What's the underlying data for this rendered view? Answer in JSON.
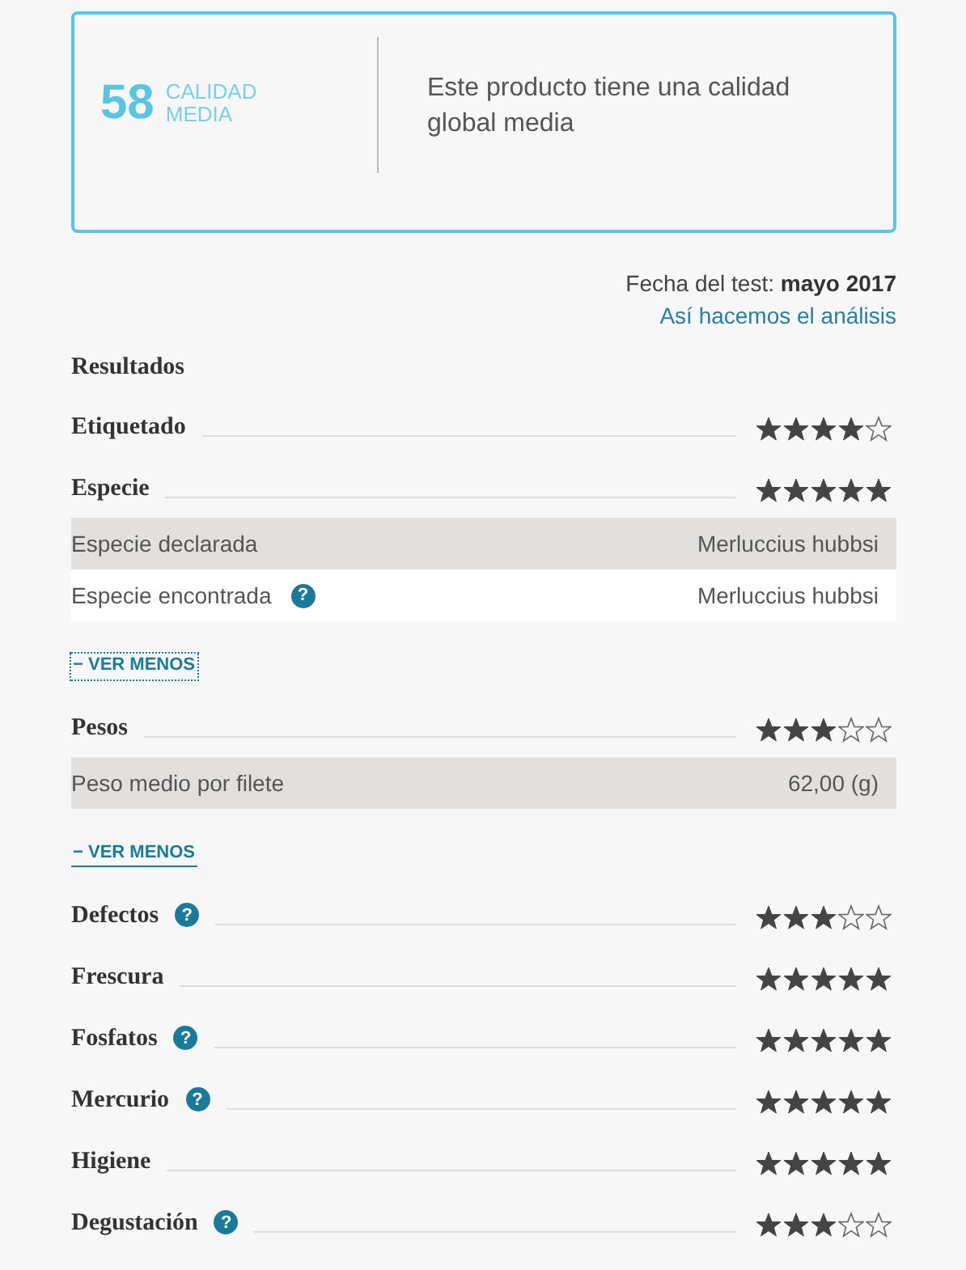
{
  "summary": {
    "score": "58",
    "grade_line_1": "CALIDAD",
    "grade_line_2": "MEDIA",
    "description": "Este producto tiene una calidad global media"
  },
  "test_date": {
    "label": "Fecha del test:",
    "value": "mayo 2017"
  },
  "method_link": "Así hacemos el análisis",
  "results_heading": "Resultados",
  "rows": [
    {
      "kind": "rating",
      "label": "Etiquetado",
      "stars": 4
    },
    {
      "kind": "rating",
      "label": "Especie",
      "stars": 5
    },
    {
      "kind": "detail",
      "label": "Especie declarada",
      "value": "Merluccius hubbsi",
      "shaded": true
    },
    {
      "kind": "detail",
      "label": "Especie encontrada",
      "help": "?",
      "value": "Merluccius hubbsi",
      "shaded": false
    },
    {
      "kind": "toggle",
      "label": "− VER MENOS",
      "focused": true
    },
    {
      "kind": "rating",
      "label": "Pesos",
      "stars": 3
    },
    {
      "kind": "detail",
      "label": "Peso medio por filete",
      "value": "62,00 (g)",
      "shaded": true
    },
    {
      "kind": "toggle",
      "label": "− VER MENOS",
      "focused": false
    },
    {
      "kind": "rating",
      "label": "Defectos",
      "help": "?",
      "stars": 3
    },
    {
      "kind": "rating",
      "label": "Frescura",
      "stars": 5
    },
    {
      "kind": "rating",
      "label": "Fosfatos",
      "help": "?",
      "stars": 5
    },
    {
      "kind": "rating",
      "label": "Mercurio",
      "help": "?",
      "stars": 5
    },
    {
      "kind": "rating",
      "label": "Higiene",
      "stars": 5
    },
    {
      "kind": "rating",
      "label": "Degustación",
      "help": "?",
      "stars": 3
    }
  ]
}
